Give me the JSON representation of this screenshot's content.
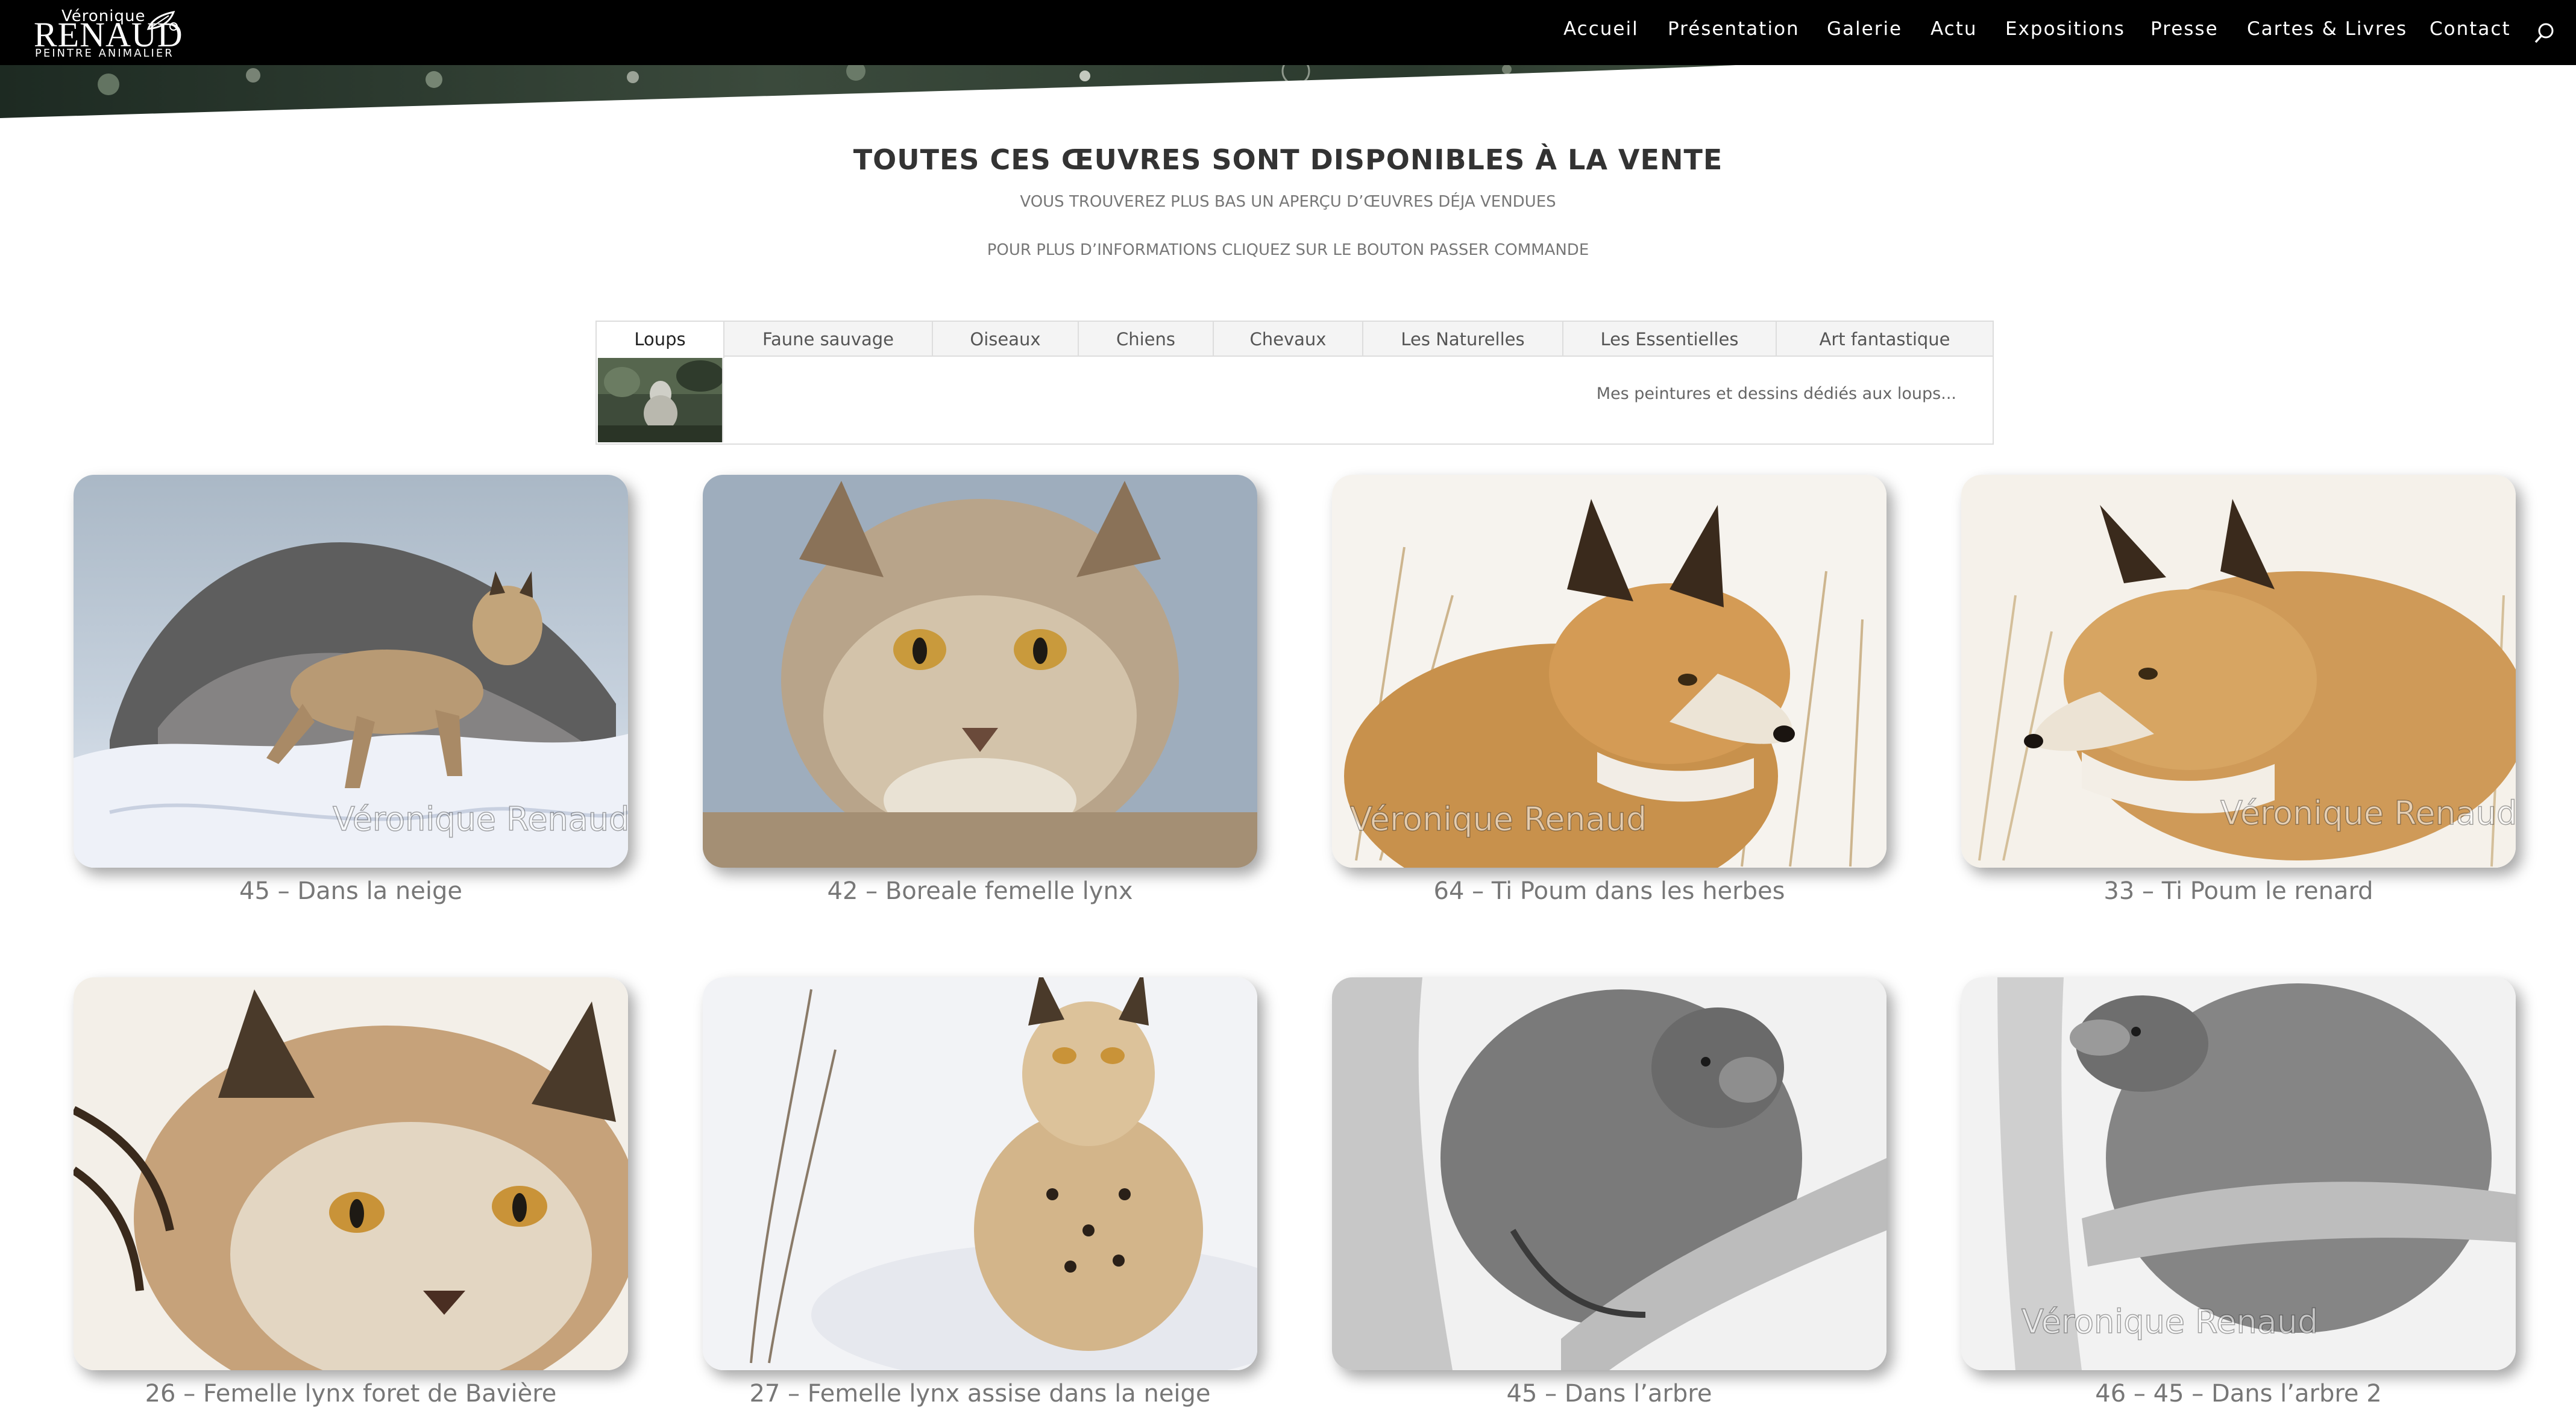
{
  "logo": {
    "first_name": "Véronique",
    "last_name": "RENAUD",
    "subtitle": "PEINTRE ANIMALIER"
  },
  "nav": {
    "items": [
      "Accueil",
      "Présentation",
      "Galerie",
      "Actu",
      "Expositions",
      "Presse",
      "Cartes & Livres",
      "Contact"
    ],
    "search_icon": "search-icon"
  },
  "intro": {
    "title": "TOUTES CES ŒUVRES SONT DISPONIBLES À LA VENTE",
    "line1": "VOUS TROUVEREZ PLUS BAS UN APERÇU D’ŒUVRES  DÉJA VENDUES",
    "line2": "POUR PLUS D’INFORMATIONS CLIQUEZ SUR LE BOUTON PASSER COMMANDE"
  },
  "tabs": {
    "items": [
      "Loups",
      "Faune sauvage",
      "Oiseaux",
      "Chiens",
      "Chevaux",
      "Les Naturelles",
      "Les Essentielles",
      "Art fantastique"
    ],
    "active": "Loups",
    "description": "Mes peintures et dessins dédiés aux loups..."
  },
  "gallery": {
    "watermark": "Véronique Renaud",
    "items": [
      {
        "caption": "45 – Dans la neige"
      },
      {
        "caption": "42 – Boreale femelle lynx"
      },
      {
        "caption": "64 – Ti Poum dans les herbes"
      },
      {
        "caption": "33 – Ti Poum le renard"
      },
      {
        "caption": "26 – Femelle lynx foret de Bavière"
      },
      {
        "caption": "27 – Femelle lynx assise dans la neige"
      },
      {
        "caption": "45 – Dans l’arbre"
      },
      {
        "caption": "46 – 45 – Dans l’arbre 2"
      }
    ]
  }
}
